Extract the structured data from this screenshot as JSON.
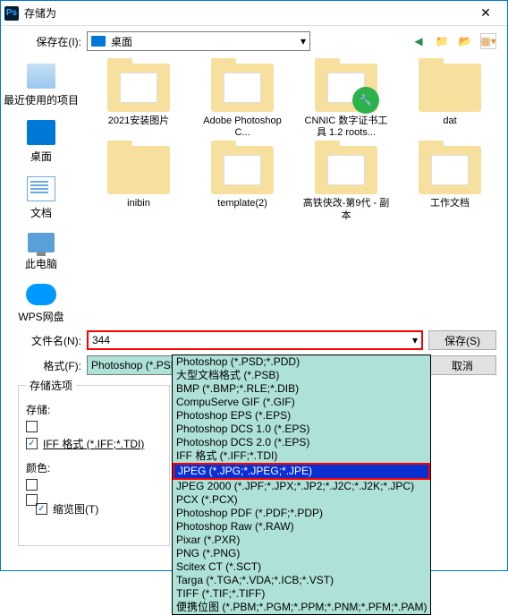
{
  "title": "存储为",
  "save_in_label": "保存在(I):",
  "location": "桌面",
  "sidebar": [
    {
      "label": "最近使用的项目"
    },
    {
      "label": "桌面"
    },
    {
      "label": "文档"
    },
    {
      "label": "此电脑"
    },
    {
      "label": "WPS网盘"
    }
  ],
  "files": [
    {
      "label": "2021安装图片"
    },
    {
      "label": "Adobe Photoshop C..."
    },
    {
      "label": "CNNIC 数字证书工具 1.2 roots..."
    },
    {
      "label": "dat"
    },
    {
      "label": "inibin"
    },
    {
      "label": "template(2)"
    },
    {
      "label": "高铁侠改-第9代 - 副本"
    },
    {
      "label": "工作文档"
    }
  ],
  "filename_label": "文件名(N):",
  "filename_value": "344",
  "format_label": "格式(F):",
  "format_value": "Photoshop (*.PSD;*.PDD)",
  "save_btn": "保存(S)",
  "cancel_btn": "取消",
  "options_title": "存储选项",
  "options_store": "存储:",
  "options_color": "颜色:",
  "iff_label": "IFF 格式 (*.IFF;*.TDI)",
  "thumbnail": "缩览图(T)",
  "formats": [
    "Photoshop (*.PSD;*.PDD)",
    "大型文档格式 (*.PSB)",
    "BMP (*.BMP;*.RLE;*.DIB)",
    "CompuServe GIF (*.GIF)",
    "Photoshop EPS (*.EPS)",
    "Photoshop DCS 1.0 (*.EPS)",
    "Photoshop DCS 2.0 (*.EPS)",
    "IFF 格式 (*.IFF;*.TDI)",
    "JPEG (*.JPG;*.JPEG;*.JPE)",
    "JPEG 2000 (*.JPF;*.JPX;*.JP2;*.J2C;*.J2K;*.JPC)",
    "PCX (*.PCX)",
    "Photoshop PDF (*.PDF;*.PDP)",
    "Photoshop Raw (*.RAW)",
    "Pixar (*.PXR)",
    "PNG (*.PNG)",
    "Scitex CT (*.SCT)",
    "Targa (*.TGA;*.VDA;*.ICB;*.VST)",
    "TIFF (*.TIF;*.TIFF)",
    "便携位图 (*.PBM;*.PGM;*.PPM;*.PNM;*.PFM;*.PAM)"
  ]
}
